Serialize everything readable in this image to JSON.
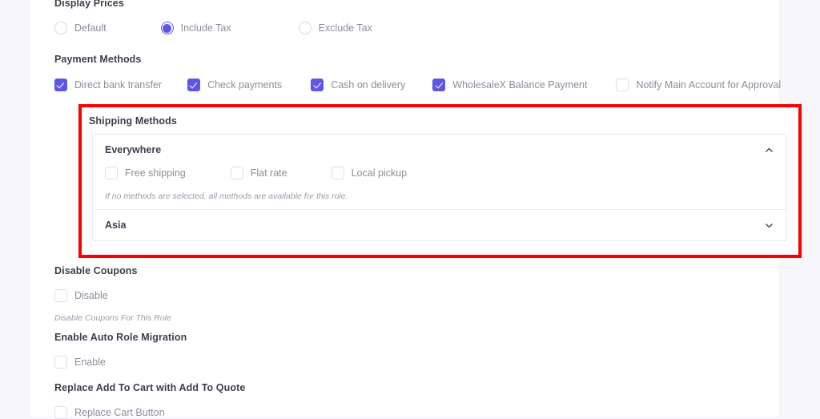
{
  "theme": {
    "accent": "#5f56e8",
    "highlight": "#fb0000",
    "page_bg": "#f7f6fb",
    "panel_bg": "#ffffff",
    "title_color": "#3b3f4c",
    "label_color": "#8b8e9b"
  },
  "display_prices": {
    "title": "Display Prices",
    "options": [
      {
        "label": "Default",
        "selected": false
      },
      {
        "label": "Include Tax",
        "selected": true
      },
      {
        "label": "Exclude Tax",
        "selected": false
      }
    ]
  },
  "payment_methods": {
    "title": "Payment Methods",
    "options": [
      {
        "label": "Direct bank transfer",
        "checked": true
      },
      {
        "label": "Check payments",
        "checked": true
      },
      {
        "label": "Cash on delivery",
        "checked": true
      },
      {
        "label": "WholesaleX Balance Payment",
        "checked": true
      },
      {
        "label": "Notify Main Account for Approval",
        "checked": false
      }
    ]
  },
  "shipping_methods": {
    "title": "Shipping Methods",
    "highlighted": true,
    "zones": [
      {
        "name": "Everywhere",
        "expanded": true,
        "chevron": "chevron-up-icon",
        "methods": [
          {
            "label": "Free shipping",
            "checked": false
          },
          {
            "label": "Flat rate",
            "checked": false
          },
          {
            "label": "Local pickup",
            "checked": false
          }
        ],
        "helper": "If no methods are selected, all methods are available for this role."
      },
      {
        "name": "Asia",
        "expanded": false,
        "chevron": "chevron-down-icon",
        "methods": [],
        "helper": ""
      }
    ]
  },
  "disable_coupons": {
    "title": "Disable Coupons",
    "option": {
      "label": "Disable",
      "checked": false
    },
    "helper": "Disable Coupons For This Role"
  },
  "auto_role_migration": {
    "title": "Enable Auto Role Migration",
    "option": {
      "label": "Enable",
      "checked": false
    },
    "helper": ""
  },
  "replace_cart": {
    "title": "Replace Add To Cart with Add To Quote",
    "option": {
      "label": "Replace Cart Button",
      "checked": false
    },
    "helper": ""
  }
}
